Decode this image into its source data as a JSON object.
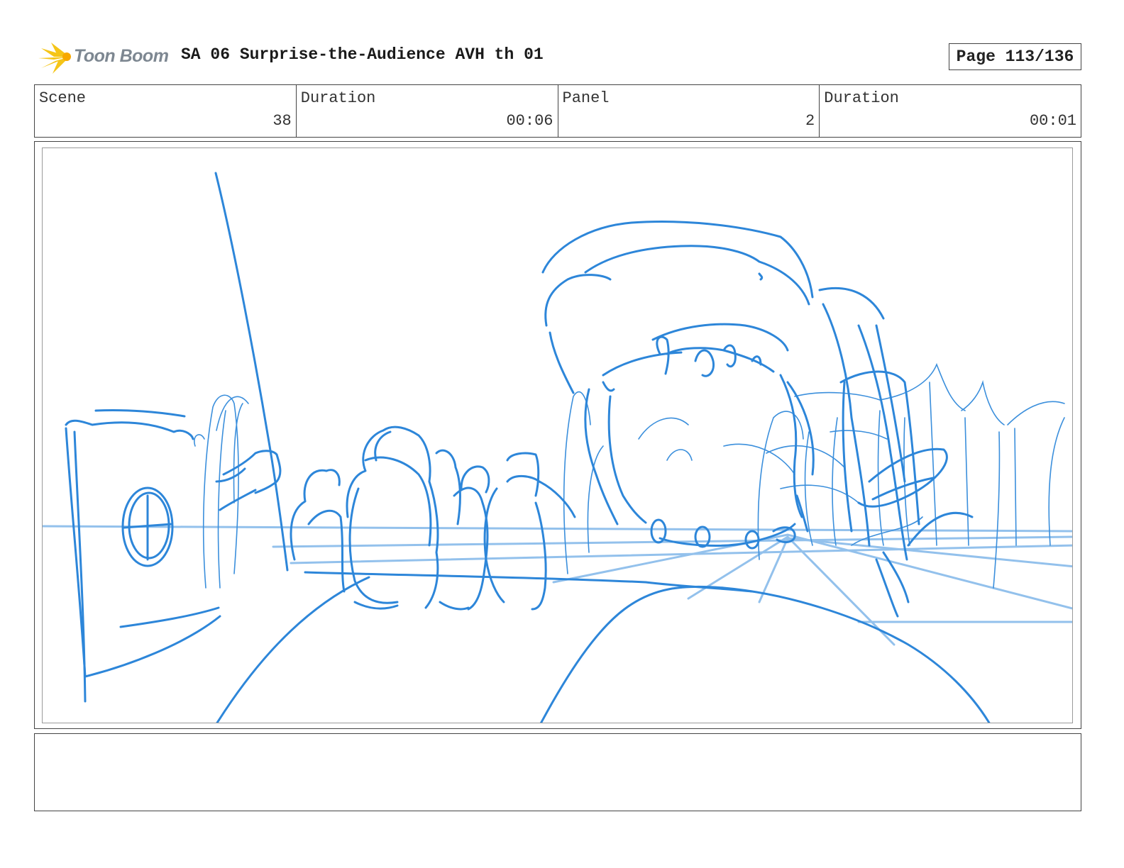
{
  "header": {
    "logo_text": "Toon Boom",
    "document_title": "SA 06 Surprise-the-Audience AVH th 01",
    "page_label": "Page 113/136"
  },
  "info": {
    "scene_label": "Scene",
    "scene_value": "38",
    "scene_duration_label": "Duration",
    "scene_duration_value": "00:06",
    "panel_label": "Panel",
    "panel_value": "2",
    "panel_duration_label": "Duration",
    "panel_duration_value": "00:01"
  },
  "colors": {
    "sketch_blue": "#2d86d9",
    "sketch_light_blue": "#93c1ec",
    "logo_yellow": "#f5c518",
    "logo_text_gray": "#7d8791"
  },
  "icons": {
    "logo": "toon-boom-starburst-icon"
  },
  "notes": {
    "text": ""
  }
}
